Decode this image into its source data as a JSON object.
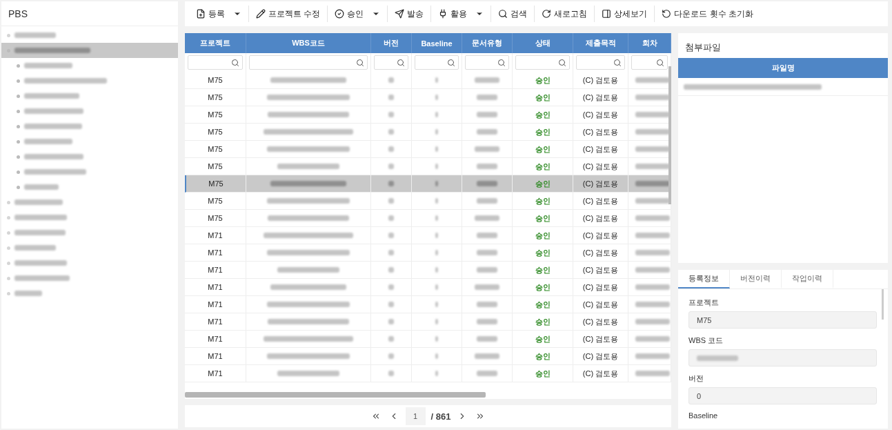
{
  "pbs_panel": {
    "title": "PBS",
    "tree": [
      {
        "selected": false,
        "expanded": false
      },
      {
        "selected": true,
        "expanded": true,
        "children": [
          {
            "selected": false
          },
          {
            "selected": false
          },
          {
            "selected": false
          },
          {
            "selected": false
          },
          {
            "selected": false
          },
          {
            "selected": false
          },
          {
            "selected": false
          },
          {
            "selected": false
          },
          {
            "selected": false
          }
        ]
      },
      {
        "selected": false,
        "expanded": false
      },
      {
        "selected": false,
        "expanded": false
      },
      {
        "selected": false,
        "expanded": false
      },
      {
        "selected": false,
        "expanded": false
      },
      {
        "selected": false,
        "expanded": false
      },
      {
        "selected": false,
        "expanded": false
      },
      {
        "selected": false,
        "expanded": false
      }
    ]
  },
  "toolbar": [
    {
      "label": "등록",
      "dropdown": true
    },
    {
      "label": "프로젝트 수정",
      "dropdown": false
    },
    {
      "label": "승인",
      "dropdown": true
    },
    {
      "label": "발송",
      "dropdown": false
    },
    {
      "label": "활용",
      "dropdown": true
    },
    {
      "label": "검색",
      "dropdown": false
    },
    {
      "label": "새로고침",
      "dropdown": false
    },
    {
      "label": "상세보기",
      "dropdown": false
    },
    {
      "label": "다운로드 횟수 초기화",
      "dropdown": false
    }
  ],
  "table": {
    "columns": [
      "프로젝트",
      "WBS코드",
      "버전",
      "Baseline",
      "문서유형",
      "상태",
      "제출목적",
      "회차"
    ],
    "rows": [
      {
        "project": "M75",
        "status": "승인",
        "purpose": "(C) 검토용",
        "selected": false
      },
      {
        "project": "M75",
        "status": "승인",
        "purpose": "(C) 검토용",
        "selected": false
      },
      {
        "project": "M75",
        "status": "승인",
        "purpose": "(C) 검토용",
        "selected": false
      },
      {
        "project": "M75",
        "status": "승인",
        "purpose": "(C) 검토용",
        "selected": false
      },
      {
        "project": "M75",
        "status": "승인",
        "purpose": "(C) 검토용",
        "selected": false
      },
      {
        "project": "M75",
        "status": "승인",
        "purpose": "(C) 검토용",
        "selected": false
      },
      {
        "project": "M75",
        "status": "승인",
        "purpose": "(C) 검토용",
        "selected": true
      },
      {
        "project": "M75",
        "status": "승인",
        "purpose": "(C) 검토용",
        "selected": false
      },
      {
        "project": "M75",
        "status": "승인",
        "purpose": "(C) 검토용",
        "selected": false
      },
      {
        "project": "M71",
        "status": "승인",
        "purpose": "(C) 검토용",
        "selected": false
      },
      {
        "project": "M71",
        "status": "승인",
        "purpose": "(C) 검토용",
        "selected": false
      },
      {
        "project": "M71",
        "status": "승인",
        "purpose": "(C) 검토용",
        "selected": false
      },
      {
        "project": "M71",
        "status": "승인",
        "purpose": "(C) 검토용",
        "selected": false
      },
      {
        "project": "M71",
        "status": "승인",
        "purpose": "(C) 검토용",
        "selected": false
      },
      {
        "project": "M71",
        "status": "승인",
        "purpose": "(C) 검토용",
        "selected": false
      },
      {
        "project": "M71",
        "status": "승인",
        "purpose": "(C) 검토용",
        "selected": false
      },
      {
        "project": "M71",
        "status": "승인",
        "purpose": "(C) 검토용",
        "selected": false
      },
      {
        "project": "M71",
        "status": "승인",
        "purpose": "(C) 검토용",
        "selected": false
      }
    ]
  },
  "pagination": {
    "page": "1",
    "total": "/ 861"
  },
  "attachments": {
    "title": "첨부파일",
    "column": "파일명"
  },
  "details": {
    "tabs": [
      {
        "label": "등록정보",
        "selected": true
      },
      {
        "label": "버전이력",
        "selected": false
      },
      {
        "label": "작업이력",
        "selected": false
      }
    ],
    "fields": [
      {
        "label": "프로젝트",
        "value": "M75"
      },
      {
        "label": "WBS 코드",
        "redacted": true
      },
      {
        "label": "버전",
        "value": "0"
      },
      {
        "label": "Baseline"
      }
    ]
  }
}
